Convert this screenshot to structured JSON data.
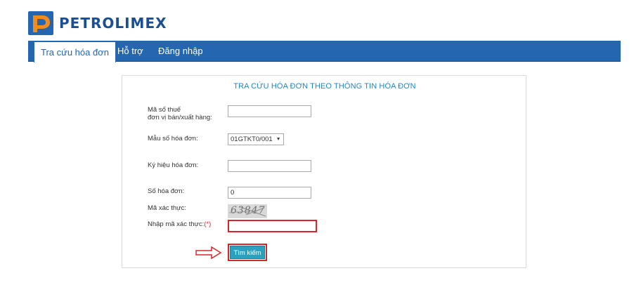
{
  "brand": {
    "name": "PETROLIMEX"
  },
  "nav": {
    "items": [
      "Tra cứu hóa đơn",
      "Hỗ trợ",
      "Đăng nhập"
    ]
  },
  "form": {
    "title": "TRA CỨU HÓA ĐƠN THEO THÔNG TIN HÓA ĐƠN",
    "tax_label_line1": "Mã số thuế",
    "tax_label_line2": "đơn vị bán/xuất hàng:",
    "tax_value": "",
    "template_label": "Mẫu số hóa đơn:",
    "template_selected": "01GTKT0/001",
    "symbol_label": "Ký hiệu hóa đơn:",
    "symbol_value": "",
    "number_label": "Số hóa đơn:",
    "number_value": "0",
    "captcha_label": "Mã xác thực:",
    "captcha_text": "63847",
    "captcha_input_label": "Nhập mã xác thực:",
    "required_mark": "(*)",
    "captcha_input_value": "",
    "search_button": "Tìm kiếm"
  },
  "colors": {
    "nav_bg": "#2566b0",
    "title": "#1f87c7",
    "button": "#2aa1be",
    "highlight": "#d6262a",
    "brand_text": "#1b4e93"
  }
}
